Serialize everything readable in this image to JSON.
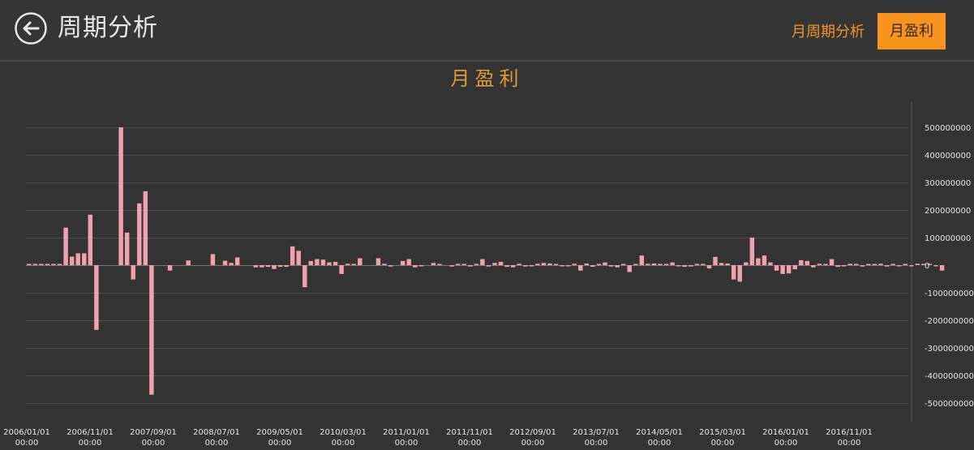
{
  "header": {
    "title": "周期分析",
    "tabs": [
      {
        "label": "月周期分析",
        "active": false
      },
      {
        "label": "月盈利",
        "active": true
      }
    ]
  },
  "colors": {
    "accent": "#f7931e",
    "bar": "#f1a0ae",
    "background": "#333333",
    "grid": "#4e4e4e"
  },
  "chart_data": {
    "type": "bar",
    "title": "月盈利",
    "ylim": [
      -500000000,
      500000000
    ],
    "y_ticks": [
      500000000,
      400000000,
      300000000,
      200000000,
      100000000,
      0,
      -100000000,
      -200000000,
      -300000000,
      -400000000,
      -500000000
    ],
    "x_tick_labels": [
      [
        "2006/01/01",
        "00:00"
      ],
      [
        "2006/11/01",
        "00:00"
      ],
      [
        "2007/09/01",
        "00:00"
      ],
      [
        "2008/07/01",
        "00:00"
      ],
      [
        "2009/05/01",
        "00:00"
      ],
      [
        "2010/03/01",
        "00:00"
      ],
      [
        "2011/01/01",
        "00:00"
      ],
      [
        "2011/11/01",
        "00:00"
      ],
      [
        "2012/09/01",
        "00:00"
      ],
      [
        "2013/07/01",
        "00:00"
      ],
      [
        "2014/05/01",
        "00:00"
      ],
      [
        "2015/03/01",
        "00:00"
      ],
      [
        "2016/01/01",
        "00:00"
      ],
      [
        "2016/11/01",
        "00:00"
      ]
    ],
    "grid": true,
    "y_axis_position": "right",
    "start_month": "2006/01",
    "values": [
      1000000,
      1000000,
      1000000,
      1000000,
      1000000,
      1000000,
      136000000,
      31000000,
      43000000,
      43000000,
      183000000,
      -235000000,
      0,
      0,
      0,
      500000000,
      118000000,
      -52000000,
      224000000,
      268000000,
      -470000000,
      0,
      0,
      -20000000,
      0,
      0,
      17000000,
      0,
      0,
      0,
      40000000,
      0,
      16000000,
      8000000,
      28000000,
      0,
      0,
      -8000000,
      -8000000,
      -6000000,
      -14000000,
      -6000000,
      -6000000,
      68000000,
      52000000,
      -80000000,
      15000000,
      22000000,
      20000000,
      10000000,
      12000000,
      -32000000,
      5000000,
      2000000,
      25000000,
      0,
      0,
      25000000,
      5000000,
      -5000000,
      0,
      15000000,
      22000000,
      -8000000,
      -4000000,
      0,
      8000000,
      4000000,
      0,
      -5000000,
      3000000,
      4000000,
      -5000000,
      2000000,
      22000000,
      -5000000,
      8000000,
      12000000,
      -6000000,
      -8000000,
      5000000,
      -5000000,
      -4000000,
      5000000,
      8000000,
      6000000,
      4000000,
      -4000000,
      -4000000,
      5000000,
      -20000000,
      6000000,
      -6000000,
      4000000,
      10000000,
      -5000000,
      -8000000,
      3000000,
      -25000000,
      2000000,
      35000000,
      5000000,
      6000000,
      3000000,
      4000000,
      10000000,
      -4000000,
      -6000000,
      -5000000,
      2000000,
      3000000,
      -12000000,
      30000000,
      8000000,
      6000000,
      -52000000,
      -60000000,
      10000000,
      100000000,
      25000000,
      35000000,
      10000000,
      -20000000,
      -32000000,
      -30000000,
      -15000000,
      18000000,
      15000000,
      -8000000,
      5000000,
      4000000,
      22000000,
      -6000000,
      -4000000,
      5000000,
      4000000,
      -5000000,
      3000000,
      2000000,
      5000000,
      -5000000,
      3000000,
      -4000000,
      3000000,
      -2000000,
      5000000,
      4000000,
      3000000,
      -4000000,
      -20000000
    ]
  }
}
